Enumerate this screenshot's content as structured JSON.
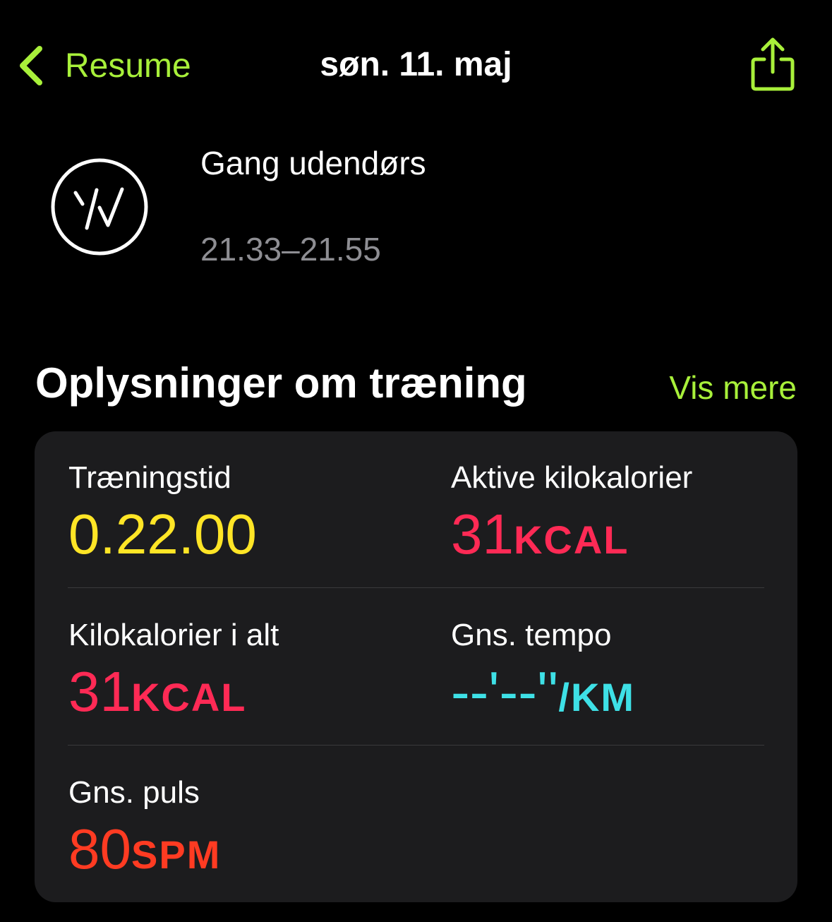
{
  "nav": {
    "back_label": "Resume",
    "title": "søn. 11. maj",
    "share_icon": "share-icon"
  },
  "workout": {
    "icon": "walking-icon",
    "name": "Gang udendørs",
    "time_range": "21.33–21.55"
  },
  "details": {
    "title": "Oplysninger om træning",
    "show_more": "Vis mere",
    "metrics": [
      {
        "label": "Træningstid",
        "value": "0.22.00",
        "unit": "",
        "color": "#ffe526"
      },
      {
        "label": "Aktive kilokalorier",
        "value": "31",
        "unit": "KCAL",
        "color": "#ff2a55"
      },
      {
        "label": "Kilokalorier i alt",
        "value": "31",
        "unit": "KCAL",
        "color": "#ff2a55"
      },
      {
        "label": "Gns. tempo",
        "value": "--'--''",
        "unit": "/KM",
        "color": "#3ee0e6"
      },
      {
        "label": "Gns. puls",
        "value": "80",
        "unit": "SPM",
        "color": "#ff3b22"
      }
    ]
  },
  "colors": {
    "accent": "#a8f03a",
    "card_bg": "#1c1c1e",
    "secondary_text": "#8e8e93"
  }
}
